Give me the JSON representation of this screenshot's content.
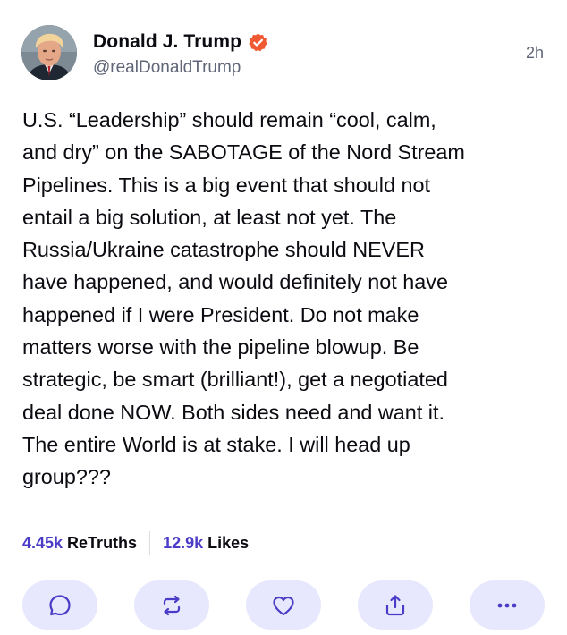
{
  "post": {
    "author": {
      "display_name": "Donald J. Trump",
      "handle": "@realDonaldTrump",
      "verified": true,
      "verified_icon": "verified-badge-icon"
    },
    "timestamp": "2h",
    "body": "U.S. “Leadership” should remain “cool, calm,\nand dry” on the SABOTAGE of the Nord Stream\nPipelines. This is a big event that should not\nentail a big solution, at least not yet. The\nRussia/Ukraine catastrophe should NEVER\nhave happened, and would definitely not have\nhappened if I were President. Do not make\nmatters worse with the pipeline blowup. Be\nstrategic, be smart (brilliant!), get a negotiated\ndeal done NOW. Both sides need and want it.\nThe entire World is at stake. I will head up\ngroup???",
    "stats": {
      "retruths_count": "4.45k",
      "retruths_label": "ReTruths",
      "likes_count": "12.9k",
      "likes_label": "Likes"
    },
    "actions": [
      {
        "name": "reply",
        "icon": "comment-icon"
      },
      {
        "name": "retruth",
        "icon": "retruth-icon"
      },
      {
        "name": "like",
        "icon": "heart-icon"
      },
      {
        "name": "share",
        "icon": "share-icon"
      },
      {
        "name": "more",
        "icon": "more-icon"
      }
    ]
  },
  "colors": {
    "accent": "#4b3cc7",
    "verified_badge": "#f05a32",
    "action_bg": "#e7e8fd",
    "icon": "#4b3cc7",
    "muted_text": "#606677",
    "text": "#0b0b12"
  }
}
